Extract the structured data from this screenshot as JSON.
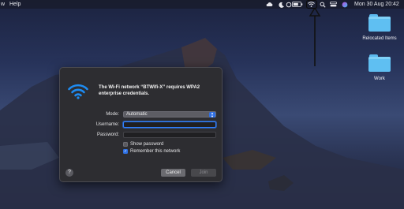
{
  "menubar": {
    "left_items": [
      "w",
      "Help"
    ],
    "date_time": "Mon 30 Aug  20:42",
    "icons": [
      "cloud-icon",
      "moon-icon",
      "sync-icon",
      "battery-icon",
      "wifi-icon",
      "search-icon",
      "control-center-icon",
      "siri-icon"
    ]
  },
  "desktop_items": [
    {
      "label": "Relocated Items",
      "icon": "folder-icon"
    },
    {
      "label": "Work",
      "icon": "folder-icon"
    }
  ],
  "dialog": {
    "message": "The Wi-Fi network “BTWifi-X” requires WPA2 enterprise credentials.",
    "mode_label": "Mode:",
    "mode_value": "Automatic",
    "username_label": "Username:",
    "username_value": "",
    "password_label": "Password:",
    "password_value": "",
    "show_password_label": "Show password",
    "show_password_checked": false,
    "remember_label": "Remember this network",
    "remember_checked": true,
    "help_label": "?",
    "cancel_label": "Cancel",
    "join_label": "Join"
  },
  "colors": {
    "accent": "#2f72e6",
    "dialog_bg": "#2d2d31",
    "wifi_icon": "#1e8cf2",
    "folder": "#5fbff2"
  }
}
